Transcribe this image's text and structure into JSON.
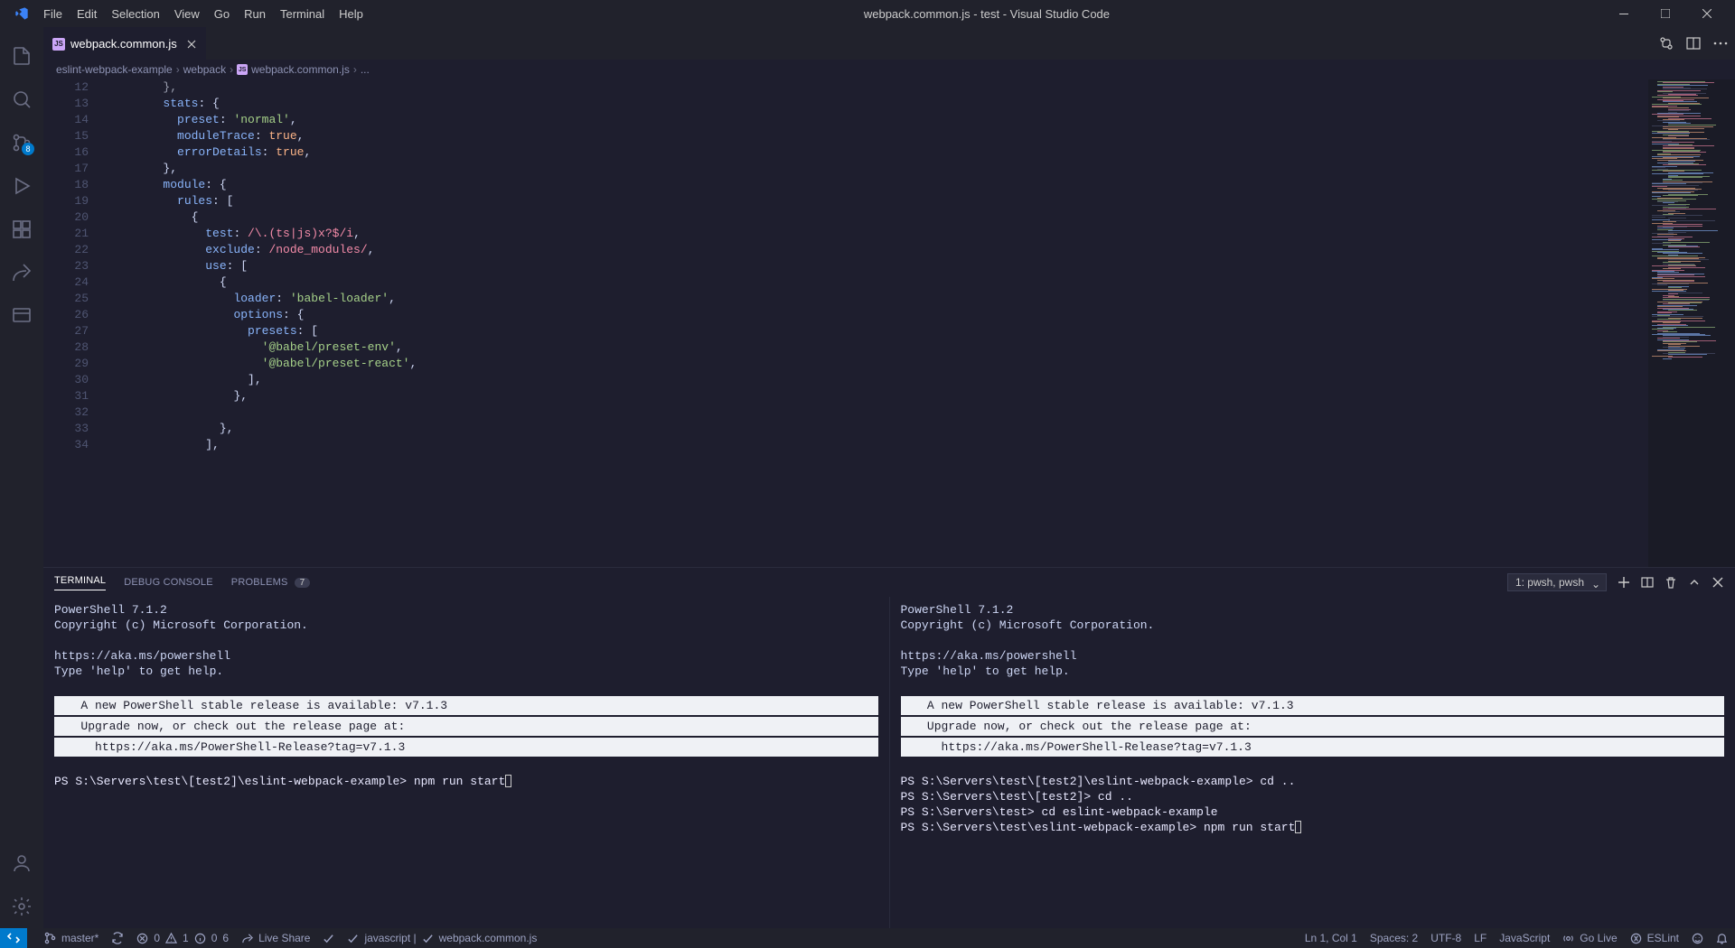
{
  "window": {
    "title": "webpack.common.js - test - Visual Studio Code"
  },
  "menu": [
    "File",
    "Edit",
    "Selection",
    "View",
    "Go",
    "Run",
    "Terminal",
    "Help"
  ],
  "activity": {
    "source_control_badge": "8"
  },
  "tab": {
    "filename": "webpack.common.js"
  },
  "tabactions": {
    "compare_tip": "",
    "split_tip": "",
    "more_tip": ""
  },
  "breadcrumbs": {
    "seg0": "eslint-webpack-example",
    "seg1": "webpack",
    "seg2": "webpack.common.js",
    "seg3": "..."
  },
  "editor": {
    "line_start": 12,
    "lines": [
      {
        "n": 12,
        "indent": 8,
        "t": [
          {
            "c": "kw",
            "s": "},"
          }
        ]
      },
      {
        "n": 13,
        "indent": 8,
        "t": [
          {
            "c": "prop",
            "s": "stats"
          },
          {
            "c": "punc",
            "s": ": {"
          }
        ]
      },
      {
        "n": 14,
        "indent": 10,
        "t": [
          {
            "c": "prop",
            "s": "preset"
          },
          {
            "c": "punc",
            "s": ": "
          },
          {
            "c": "str",
            "s": "'normal'"
          },
          {
            "c": "punc",
            "s": ","
          }
        ]
      },
      {
        "n": 15,
        "indent": 10,
        "t": [
          {
            "c": "prop",
            "s": "moduleTrace"
          },
          {
            "c": "punc",
            "s": ": "
          },
          {
            "c": "bool",
            "s": "true"
          },
          {
            "c": "punc",
            "s": ","
          }
        ]
      },
      {
        "n": 16,
        "indent": 10,
        "t": [
          {
            "c": "prop",
            "s": "errorDetails"
          },
          {
            "c": "punc",
            "s": ": "
          },
          {
            "c": "bool",
            "s": "true"
          },
          {
            "c": "punc",
            "s": ","
          }
        ]
      },
      {
        "n": 17,
        "indent": 8,
        "t": [
          {
            "c": "punc",
            "s": "},"
          }
        ]
      },
      {
        "n": 18,
        "indent": 8,
        "t": [
          {
            "c": "prop",
            "s": "module"
          },
          {
            "c": "punc",
            "s": ": {"
          }
        ]
      },
      {
        "n": 19,
        "indent": 10,
        "t": [
          {
            "c": "prop",
            "s": "rules"
          },
          {
            "c": "punc",
            "s": ": ["
          }
        ]
      },
      {
        "n": 20,
        "indent": 12,
        "t": [
          {
            "c": "punc",
            "s": "{"
          }
        ]
      },
      {
        "n": 21,
        "indent": 14,
        "t": [
          {
            "c": "prop",
            "s": "test"
          },
          {
            "c": "punc",
            "s": ": "
          },
          {
            "c": "regex",
            "s": "/\\.(ts|js)x?$/i"
          },
          {
            "c": "punc",
            "s": ","
          }
        ]
      },
      {
        "n": 22,
        "indent": 14,
        "t": [
          {
            "c": "prop",
            "s": "exclude"
          },
          {
            "c": "punc",
            "s": ": "
          },
          {
            "c": "regex",
            "s": "/node_modules/"
          },
          {
            "c": "punc",
            "s": ","
          }
        ]
      },
      {
        "n": 23,
        "indent": 14,
        "t": [
          {
            "c": "prop",
            "s": "use"
          },
          {
            "c": "punc",
            "s": ": ["
          }
        ]
      },
      {
        "n": 24,
        "indent": 16,
        "t": [
          {
            "c": "punc",
            "s": "{"
          }
        ]
      },
      {
        "n": 25,
        "indent": 18,
        "t": [
          {
            "c": "prop",
            "s": "loader"
          },
          {
            "c": "punc",
            "s": ": "
          },
          {
            "c": "str",
            "s": "'babel-loader'"
          },
          {
            "c": "punc",
            "s": ","
          }
        ]
      },
      {
        "n": 26,
        "indent": 18,
        "t": [
          {
            "c": "prop",
            "s": "options"
          },
          {
            "c": "punc",
            "s": ": {"
          }
        ]
      },
      {
        "n": 27,
        "indent": 20,
        "t": [
          {
            "c": "prop",
            "s": "presets"
          },
          {
            "c": "punc",
            "s": ": ["
          }
        ]
      },
      {
        "n": 28,
        "indent": 22,
        "t": [
          {
            "c": "str",
            "s": "'@babel/preset-env'"
          },
          {
            "c": "punc",
            "s": ","
          }
        ]
      },
      {
        "n": 29,
        "indent": 22,
        "t": [
          {
            "c": "str",
            "s": "'@babel/preset-react'"
          },
          {
            "c": "punc",
            "s": ","
          }
        ]
      },
      {
        "n": 30,
        "indent": 20,
        "t": [
          {
            "c": "punc",
            "s": "],"
          }
        ]
      },
      {
        "n": 31,
        "indent": 18,
        "t": [
          {
            "c": "punc",
            "s": "},"
          }
        ]
      },
      {
        "n": 32,
        "indent": 16,
        "t": []
      },
      {
        "n": 33,
        "indent": 16,
        "t": [
          {
            "c": "punc",
            "s": "},"
          }
        ]
      },
      {
        "n": 34,
        "indent": 14,
        "t": [
          {
            "c": "punc",
            "s": "],"
          }
        ]
      }
    ]
  },
  "panel": {
    "tabs": {
      "terminal": "TERMINAL",
      "debug": "DEBUG CONSOLE",
      "problems": "PROBLEMS",
      "problems_count": "7"
    },
    "selector": "1: pwsh, pwsh",
    "terminals": {
      "left": {
        "header1": "PowerShell 7.1.2",
        "header2": "Copyright (c) Microsoft Corporation.",
        "link": "https://aka.ms/powershell",
        "help": "Type 'help' to get help.",
        "notice1": "   A new PowerShell stable release is available: v7.1.3",
        "notice2": "   Upgrade now, or check out the release page at:",
        "notice3": "     https://aka.ms/PowerShell-Release?tag=v7.1.3",
        "prompt1": "PS S:\\Servers\\test\\[test2]\\eslint-webpack-example> npm run start"
      },
      "right": {
        "header1": "PowerShell 7.1.2",
        "header2": "Copyright (c) Microsoft Corporation.",
        "link": "https://aka.ms/powershell",
        "help": "Type 'help' to get help.",
        "notice1": "   A new PowerShell stable release is available: v7.1.3",
        "notice2": "   Upgrade now, or check out the release page at:",
        "notice3": "     https://aka.ms/PowerShell-Release?tag=v7.1.3",
        "prompt1": "PS S:\\Servers\\test\\[test2]\\eslint-webpack-example> cd ..",
        "prompt2": "PS S:\\Servers\\test\\[test2]> cd ..",
        "prompt3": "PS S:\\Servers\\test> cd eslint-webpack-example",
        "prompt4": "PS S:\\Servers\\test\\eslint-webpack-example> npm run start"
      }
    }
  },
  "status": {
    "remote": "",
    "branch": "master*",
    "sync": "",
    "errors": "0",
    "warnings": "1",
    "infos": "0",
    "hints": "6",
    "liveshare": "Live Share",
    "prettier": "",
    "lang_detect": "javascript | ",
    "lang_file": "webpack.common.js",
    "ln_col": "Ln 1, Col 1",
    "spaces": "Spaces: 2",
    "encoding": "UTF-8",
    "eol": "LF",
    "language": "JavaScript",
    "golive": "Go Live",
    "eslint": "ESLint"
  }
}
